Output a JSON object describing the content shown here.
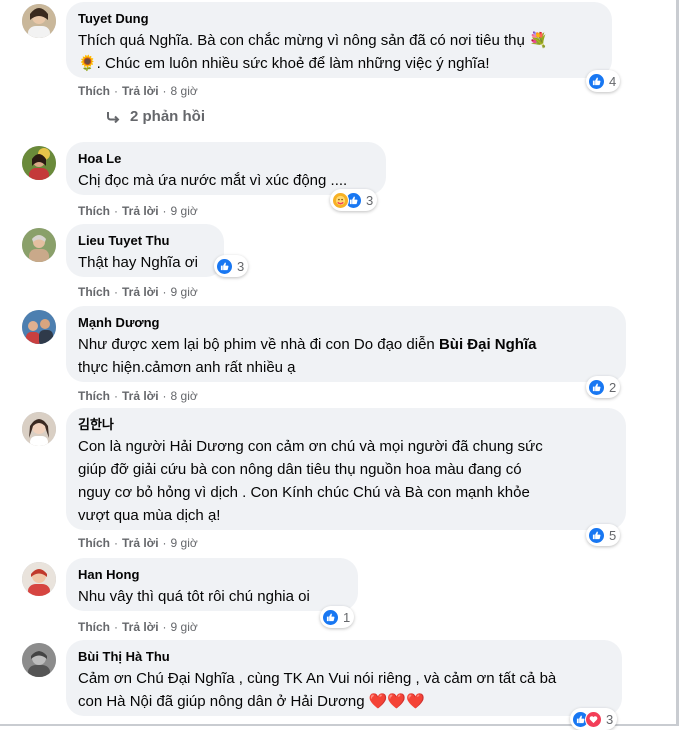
{
  "comments": [
    {
      "author": "Tuyet Dung",
      "lines": [
        "Thích quá Nghĩa. Bà con chắc mừng vì nông sản đã có nơi tiêu thụ 💐",
        "🌻. Chúc em luôn nhiều sức khoẻ để làm những việc ý nghĩa!"
      ],
      "reaction_count": "4",
      "reactions": [
        "like"
      ],
      "like_label": "Thích",
      "reply_label": "Trả lời",
      "time": "8 giờ"
    },
    {
      "author": "Hoa Le",
      "lines": [
        "Chị đọc mà ứa nước mắt vì xúc động ...."
      ],
      "reaction_count": "3",
      "reactions": [
        "care",
        "like"
      ],
      "like_label": "Thích",
      "reply_label": "Trả lời",
      "time": "9 giờ"
    },
    {
      "author": "Lieu Tuyet Thu",
      "lines": [
        "Thật hay Nghĩa ơi"
      ],
      "reaction_count": "3",
      "reactions": [
        "like"
      ],
      "like_label": "Thích",
      "reply_label": "Trả lời",
      "time": "9 giờ"
    },
    {
      "author": "Mạnh Dương",
      "line1_prefix": "Như được xem lại bộ phim về nhà đi con Do đạo diễn ",
      "line1_bold": "Bùi Đại Nghĩa",
      "line2": "thực hiện.cảmơn anh rất nhiều ạ",
      "reaction_count": "2",
      "reactions": [
        "like"
      ],
      "like_label": "Thích",
      "reply_label": "Trả lời",
      "time": "8 giờ"
    },
    {
      "author": "김한나",
      "lines": [
        "Con là người Hải Dương con cảm ơn chú và mọi người đã chung sức",
        "giúp đỡ giải cứu bà con nông dân tiêu thụ nguồn hoa màu đang có",
        "nguy cơ bỏ hỏng vì dịch . Con Kính chúc Chú và Bà con mạnh khỏe",
        "vượt qua mùa dịch ạ!"
      ],
      "reaction_count": "5",
      "reactions": [
        "like"
      ],
      "like_label": "Thích",
      "reply_label": "Trả lời",
      "time": "9 giờ"
    },
    {
      "author": "Han Hong",
      "lines": [
        "Nhu vây thì quá tôt rôi chú nghia oi"
      ],
      "reaction_count": "1",
      "reactions": [
        "like"
      ],
      "like_label": "Thích",
      "reply_label": "Trả lời",
      "time": "9 giờ"
    },
    {
      "author": "Bùi Thị Hà Thu",
      "lines": [
        "Cảm ơn Chú Đại Nghĩa , cùng TK An Vui nói riêng , và cảm ơn tất cả bà",
        "con Hà Nội đã giúp nông dân ở Hải Dương ❤️❤️❤️"
      ],
      "reaction_count": "3",
      "reactions": [
        "like",
        "love"
      ],
      "like_label": "Thích",
      "reply_label": "Trả lời"
    }
  ],
  "replies_toggle": {
    "label": "2 phản hồi"
  },
  "colors": {
    "bubble": "#f0f2f5",
    "like": "#1877f2",
    "care": "#f7b125",
    "love": "#f33e58",
    "meta": "#65676b"
  },
  "icons": [
    "avatar",
    "like-reaction-icon",
    "care-reaction-icon",
    "love-reaction-icon",
    "reply-arrow-icon"
  ]
}
